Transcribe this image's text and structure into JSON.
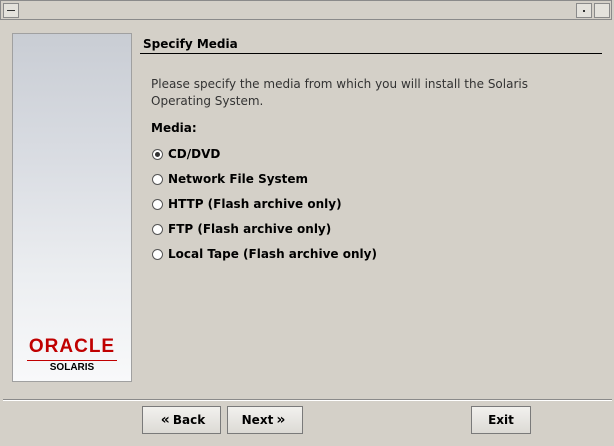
{
  "title_bar": {
    "title": ""
  },
  "section": {
    "title": "Specify Media"
  },
  "description": "Please specify the media from which you will install the Solaris Operating System.",
  "media": {
    "label": "Media:",
    "options": [
      {
        "label": "CD/DVD",
        "selected": true
      },
      {
        "label": "Network File System",
        "selected": false
      },
      {
        "label": "HTTP (Flash archive only)",
        "selected": false
      },
      {
        "label": "FTP (Flash archive only)",
        "selected": false
      },
      {
        "label": "Local Tape (Flash archive only)",
        "selected": false
      }
    ]
  },
  "branding": {
    "oracle": "ORACLE",
    "product": "SOLARIS"
  },
  "buttons": {
    "back": "Back",
    "next": "Next",
    "exit": "Exit"
  },
  "colors": {
    "oracle_red": "#c00000",
    "panel_bg": "#d4d0c8"
  }
}
